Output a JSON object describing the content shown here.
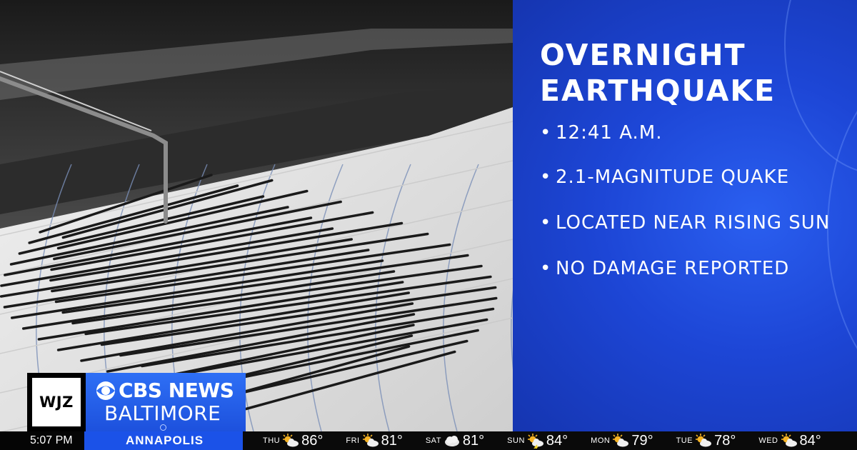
{
  "panel": {
    "title_line1": "OVERNIGHT",
    "title_line2": "EARTHQUAKE",
    "bullets": [
      "12:41 A.M.",
      "2.1-MAGNITUDE QUAKE",
      "LOCATED NEAR RISING SUN",
      "NO DAMAGE REPORTED"
    ],
    "bg_color": "#1d46d6"
  },
  "logo": {
    "station": "WJZ",
    "brand": "CBS NEWS",
    "city": "BALTIMORE",
    "brand_color": "#2e6ff5"
  },
  "ticker": {
    "time": "5:07 PM",
    "location": "ANNAPOLIS",
    "accent": "#1b52e8",
    "forecast": [
      {
        "day": "THU",
        "icon": "partly-sunny-icon",
        "temp": "86°"
      },
      {
        "day": "FRI",
        "icon": "partly-sunny-icon",
        "temp": "81°"
      },
      {
        "day": "SAT",
        "icon": "cloudy-icon",
        "temp": "81°"
      },
      {
        "day": "SUN",
        "icon": "thunderstorm-icon",
        "temp": "84°"
      },
      {
        "day": "MON",
        "icon": "partly-sunny-icon",
        "temp": "79°"
      },
      {
        "day": "TUE",
        "icon": "partly-sunny-icon",
        "temp": "78°"
      },
      {
        "day": "WED",
        "icon": "partly-sunny-icon",
        "temp": "84°"
      }
    ]
  }
}
